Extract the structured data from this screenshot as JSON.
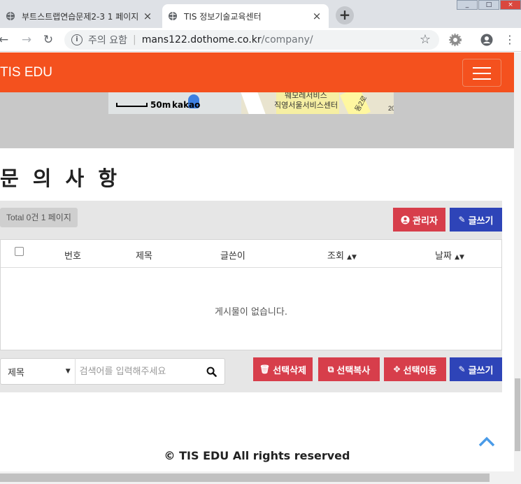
{
  "browser": {
    "tabs": [
      {
        "label": "부트스트랩연습문제2-3 1 페이지",
        "close": "×",
        "active": false
      },
      {
        "label": "TIS 정보기술교육센터",
        "close": "×",
        "active": true
      }
    ],
    "new_tab": "+",
    "address": {
      "security_text": "주의 요함",
      "separator": "|",
      "host": "mans122.dothome.co.kr",
      "path": "/company/"
    }
  },
  "site": {
    "brand": "TIS EDU",
    "accent_color": "#f4511e"
  },
  "map": {
    "scale": "50m",
    "provider": "kakao",
    "labels": [
      "웨모레서비스",
      "직영서울서비스센터",
      "동2로",
      "20"
    ]
  },
  "board": {
    "title": "문 의 사 항",
    "total": "Total 0건 1 페이지",
    "admin_button": "관리자",
    "write_button": "글쓰기",
    "columns": [
      "번호",
      "제목",
      "글쓴이",
      "조회",
      "날짜"
    ],
    "empty_message": "게시물이 없습니다.",
    "search": {
      "field": "제목",
      "placeholder": "검색어를 입력해주세요"
    },
    "actions": {
      "delete": "선택삭제",
      "copy": "선택복사",
      "move": "선택이동",
      "write": "글쓰기"
    }
  },
  "footer": {
    "text": "© TIS EDU All rights reserved"
  }
}
